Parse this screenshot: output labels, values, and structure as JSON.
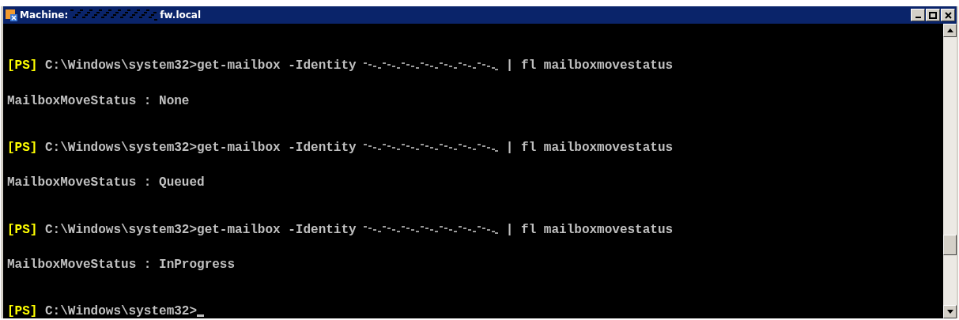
{
  "window": {
    "title_prefix": "Machine:",
    "title_redacted": true,
    "title_suffix": "fw.local"
  },
  "console": {
    "lines": [
      {
        "kind": "prompt",
        "tag": "[PS]",
        "path": "C:\\Windows\\system32>",
        "command": "get-mailbox -Identity",
        "redacted": true,
        "pipe": "| fl mailboxmovestatus"
      },
      {
        "kind": "output",
        "text": "MailboxMoveStatus : None"
      },
      {
        "kind": "prompt",
        "tag": "[PS]",
        "path": "C:\\Windows\\system32>",
        "command": "get-mailbox -Identity",
        "redacted": true,
        "pipe": "| fl mailboxmovestatus"
      },
      {
        "kind": "output",
        "text": "MailboxMoveStatus : Queued"
      },
      {
        "kind": "prompt",
        "tag": "[PS]",
        "path": "C:\\Windows\\system32>",
        "command": "get-mailbox -Identity",
        "redacted": true,
        "pipe": "| fl mailboxmovestatus"
      },
      {
        "kind": "output",
        "text": "MailboxMoveStatus : InProgress"
      },
      {
        "kind": "prompt",
        "tag": "[PS]",
        "path": "C:\\Windows\\system32>",
        "cursor": true
      }
    ]
  }
}
